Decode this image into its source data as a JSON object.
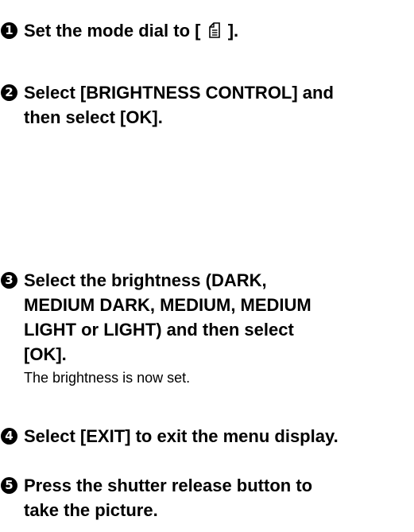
{
  "steps": [
    {
      "number": "1",
      "text_before_icon": "Set the mode dial to [",
      "icon": "print-mode-icon",
      "text_after_icon": "]."
    },
    {
      "number": "2",
      "lines": [
        "Select [BRIGHTNESS CONTROL] and",
        "then select [OK]."
      ]
    },
    {
      "number": "3",
      "lines": [
        "Select the brightness (DARK,",
        "MEDIUM DARK, MEDIUM, MEDIUM",
        "LIGHT or LIGHT) and then select",
        "[OK]."
      ],
      "note": "The brightness is now set."
    },
    {
      "number": "4",
      "lines": [
        "Select [EXIT] to exit the menu display."
      ]
    },
    {
      "number": "5",
      "lines": [
        "Press the shutter release button to",
        "take the picture."
      ]
    }
  ]
}
